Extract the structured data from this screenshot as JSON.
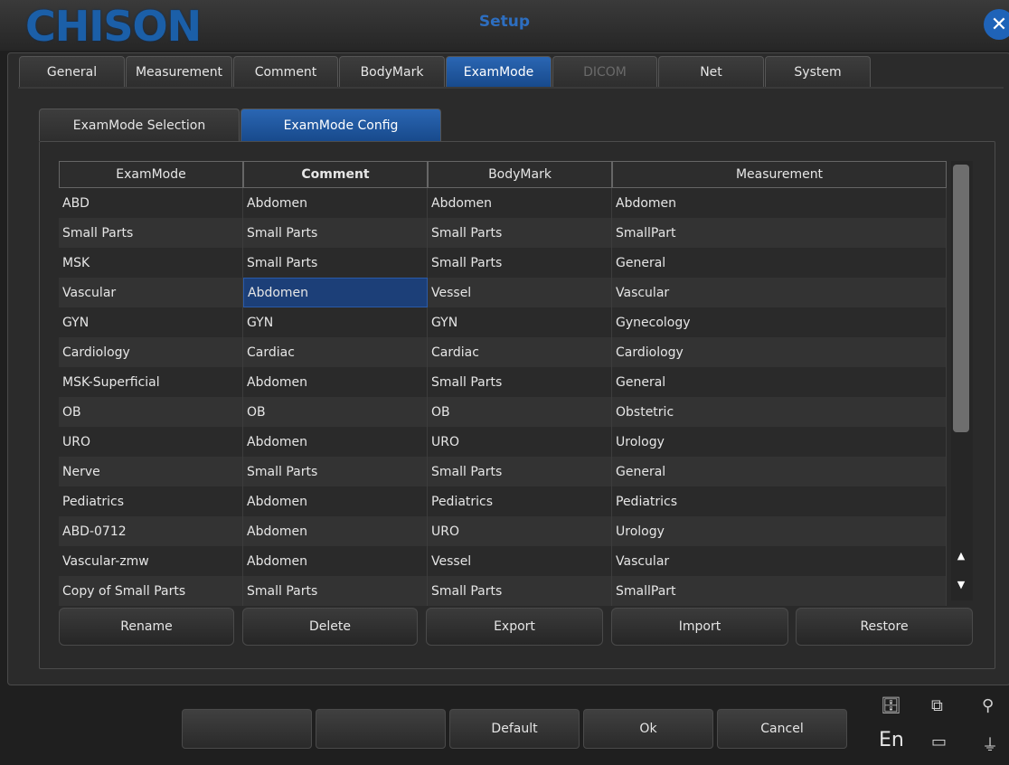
{
  "window": {
    "logo": "CHISON",
    "title": "Setup",
    "close_icon": "close-icon"
  },
  "tabs": [
    {
      "label": "General"
    },
    {
      "label": "Measurement"
    },
    {
      "label": "Comment"
    },
    {
      "label": "BodyMark"
    },
    {
      "label": "ExamMode",
      "state": "active"
    },
    {
      "label": "DICOM",
      "state": "disabled"
    },
    {
      "label": "Net"
    },
    {
      "label": "System"
    }
  ],
  "subtabs": [
    {
      "label": "ExamMode Selection"
    },
    {
      "label": "ExamMode Config",
      "state": "active"
    }
  ],
  "table": {
    "headers": [
      "ExamMode",
      "Comment",
      "BodyMark",
      "Measurement"
    ],
    "rows": [
      [
        "ABD",
        "Abdomen",
        "Abdomen",
        "Abdomen"
      ],
      [
        "Small Parts",
        "Small Parts",
        "Small Parts",
        "SmallPart"
      ],
      [
        "MSK",
        "Small Parts",
        "Small Parts",
        "General"
      ],
      [
        "Vascular",
        "Abdomen",
        "Vessel",
        "Vascular"
      ],
      [
        "GYN",
        "GYN",
        "GYN",
        "Gynecology"
      ],
      [
        "Cardiology",
        "Cardiac",
        "Cardiac",
        "Cardiology"
      ],
      [
        "MSK-Superficial",
        "Abdomen",
        "Small Parts",
        "General"
      ],
      [
        "OB",
        "OB",
        "OB",
        "Obstetric"
      ],
      [
        "URO",
        "Abdomen",
        "URO",
        "Urology"
      ],
      [
        "Nerve",
        "Small Parts",
        "Small Parts",
        "General"
      ],
      [
        "Pediatrics",
        "Abdomen",
        "Pediatrics",
        "Pediatrics"
      ],
      [
        "ABD-0712",
        "Abdomen",
        "URO",
        "Urology"
      ],
      [
        "Vascular-zmw",
        "Abdomen",
        "Vessel",
        "Vascular"
      ],
      [
        "Copy of Small Parts",
        "Small Parts",
        "Small Parts",
        "SmallPart"
      ]
    ],
    "selected": "Vascular / Comment"
  },
  "actions": {
    "rename": "Rename",
    "delete": "Delete",
    "export": "Export",
    "import": "Import",
    "restore": "Restore"
  },
  "footer": {
    "blank1": "",
    "blank2": "",
    "default": "Default",
    "ok": "Ok",
    "cancel": "Cancel"
  },
  "status": {
    "language": "En"
  },
  "colors": {
    "accent": "#1f5fb0",
    "selected_cell": "#1c3f78",
    "background": "#1f1f1f"
  }
}
